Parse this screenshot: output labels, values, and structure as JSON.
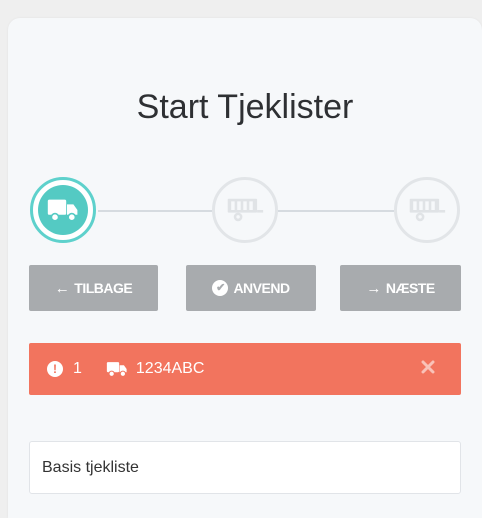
{
  "page": {
    "title": "Start Tjeklister"
  },
  "stepper": {
    "steps": [
      {
        "icon": "truck-icon",
        "state": "active"
      },
      {
        "icon": "trailer-icon",
        "state": "inactive"
      },
      {
        "icon": "trailer-icon",
        "state": "inactive"
      }
    ]
  },
  "actions": {
    "back_label": "TILBAGE",
    "back_icon": "←",
    "apply_label": "ANVEND",
    "apply_icon": "✔",
    "next_label": "NÆSTE",
    "next_icon": "→"
  },
  "alert": {
    "icon": "!",
    "count": "1",
    "plate": "1234ABC",
    "close_icon": "close-icon"
  },
  "checklist_input": {
    "value": "Basis tjekliste"
  },
  "colors": {
    "accent": "#54cac3",
    "button": "#a8abae",
    "alert": "#f2745e"
  }
}
